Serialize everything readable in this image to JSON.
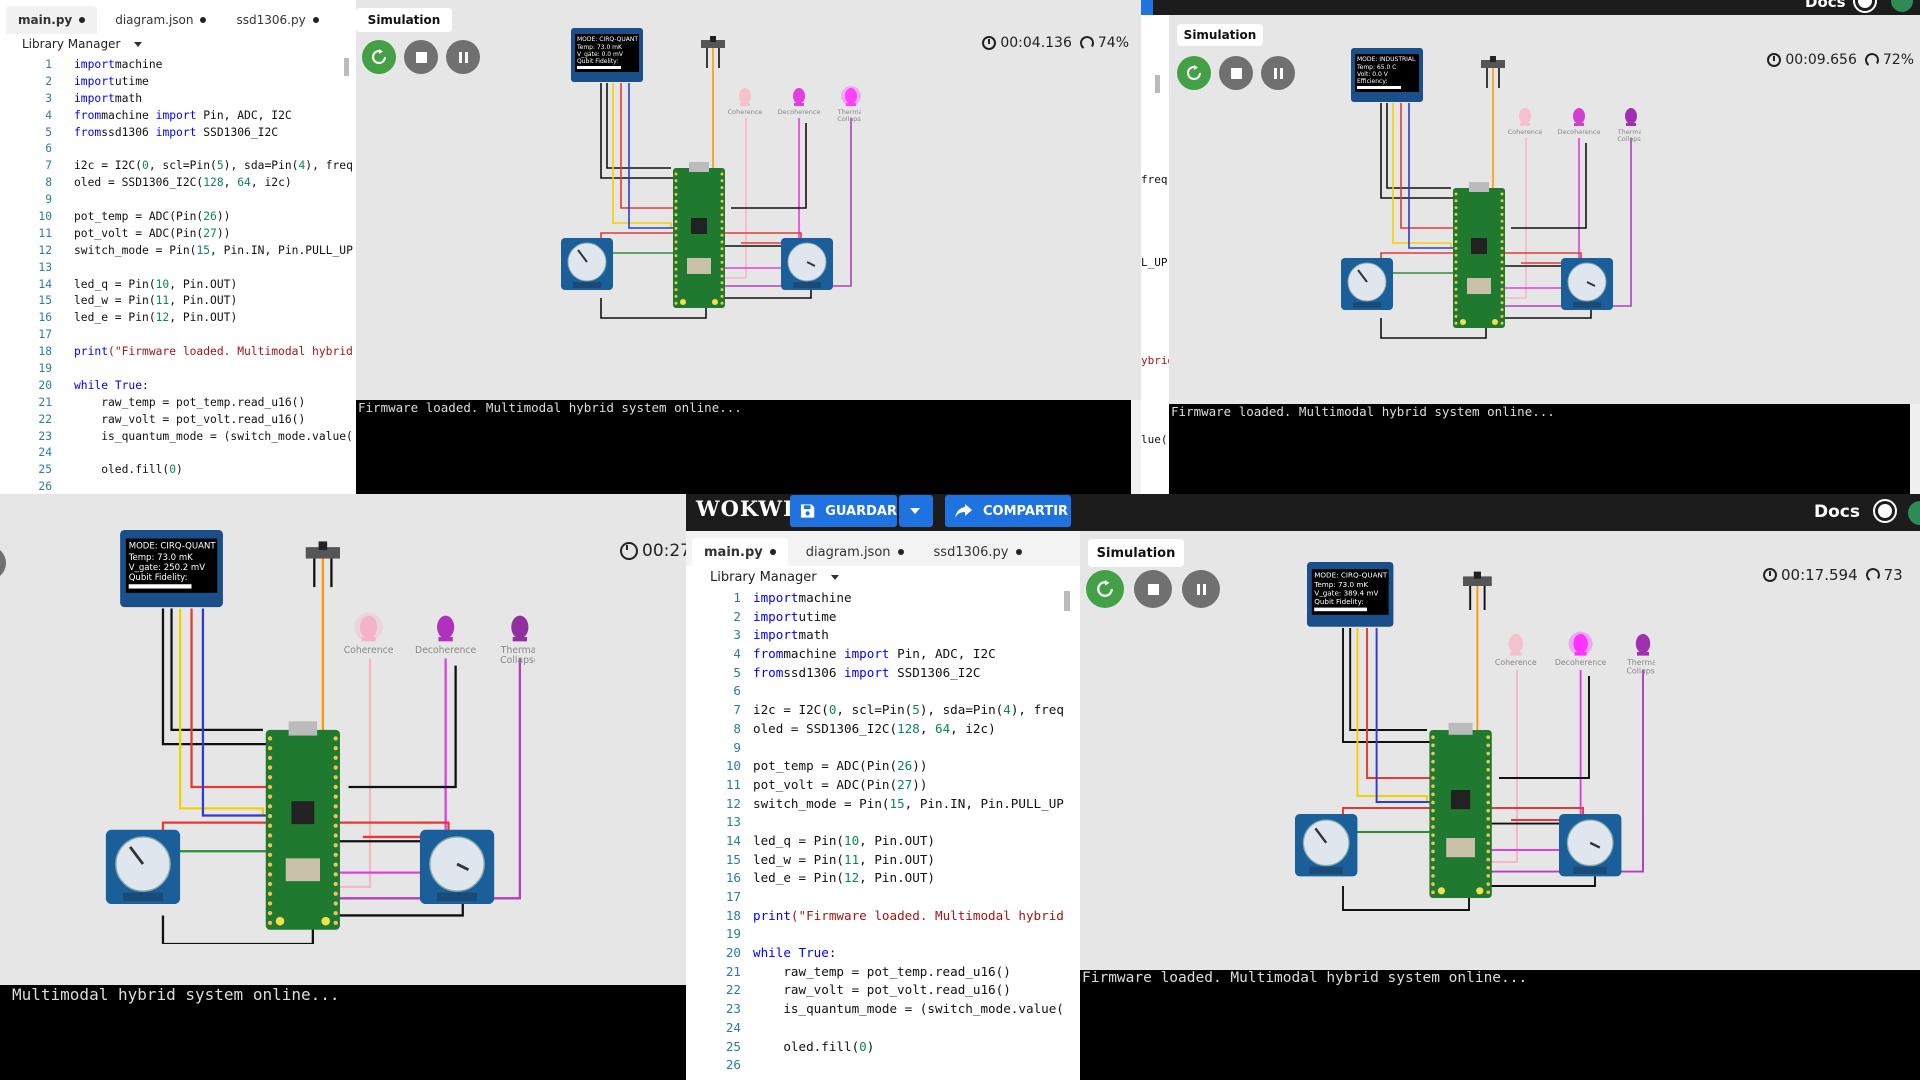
{
  "editor": {
    "tabs": [
      {
        "label": "main.py"
      },
      {
        "label": "diagram.json"
      },
      {
        "label": "ssd1306.py"
      }
    ],
    "library_manager": "Library Manager",
    "code": [
      {
        "n": "1",
        "t": [
          [
            "kw",
            "import"
          ],
          [
            "",
            "machine"
          ]
        ]
      },
      {
        "n": "2",
        "t": [
          [
            "kw",
            "import"
          ],
          [
            "",
            "utime"
          ]
        ]
      },
      {
        "n": "3",
        "t": [
          [
            "kw",
            "import"
          ],
          [
            "",
            "math"
          ]
        ]
      },
      {
        "n": "4",
        "t": [
          [
            "kw",
            "from"
          ],
          [
            "",
            "machine "
          ],
          [
            "kw",
            "import"
          ],
          [
            "",
            " Pin, ADC, I2C"
          ]
        ]
      },
      {
        "n": "5",
        "t": [
          [
            "kw",
            "from"
          ],
          [
            "",
            "ssd1306 "
          ],
          [
            "kw",
            "import"
          ],
          [
            "",
            " SSD1306_I2C"
          ]
        ]
      },
      {
        "n": "6",
        "t": []
      },
      {
        "n": "7",
        "t": [
          [
            "",
            "i2c = I2C("
          ],
          [
            "nm",
            "0"
          ],
          [
            "",
            ", scl=Pin("
          ],
          [
            "nm",
            "5"
          ],
          [
            "",
            "), sda=Pin("
          ],
          [
            "nm",
            "4"
          ],
          [
            "",
            "), freq"
          ]
        ]
      },
      {
        "n": "8",
        "t": [
          [
            "",
            "oled = SSD1306_I2C("
          ],
          [
            "nm",
            "128"
          ],
          [
            "",
            ", "
          ],
          [
            "nm",
            "64"
          ],
          [
            "",
            ", i2c)"
          ]
        ]
      },
      {
        "n": "9",
        "t": []
      },
      {
        "n": "10",
        "t": [
          [
            "",
            "pot_temp = ADC(Pin("
          ],
          [
            "nm",
            "26"
          ],
          [
            "",
            "))"
          ]
        ]
      },
      {
        "n": "11",
        "t": [
          [
            "",
            "pot_volt = ADC(Pin("
          ],
          [
            "nm",
            "27"
          ],
          [
            "",
            "))"
          ]
        ]
      },
      {
        "n": "12",
        "t": [
          [
            "",
            "switch_mode = Pin("
          ],
          [
            "nm",
            "15"
          ],
          [
            "",
            ", Pin.IN, Pin.PULL_UP"
          ]
        ]
      },
      {
        "n": "13",
        "t": []
      },
      {
        "n": "14",
        "t": [
          [
            "",
            "led_q = Pin("
          ],
          [
            "nm",
            "10"
          ],
          [
            "",
            ", Pin.OUT)"
          ]
        ]
      },
      {
        "n": "15",
        "t": [
          [
            "",
            "led_w = Pin("
          ],
          [
            "nm",
            "11"
          ],
          [
            "",
            ", Pin.OUT)"
          ]
        ]
      },
      {
        "n": "16",
        "t": [
          [
            "",
            "led_e = Pin("
          ],
          [
            "nm",
            "12"
          ],
          [
            "",
            ", Pin.OUT)"
          ]
        ]
      },
      {
        "n": "17",
        "t": []
      },
      {
        "n": "18",
        "t": [
          [
            "kw",
            "print"
          ],
          [
            "st",
            "(\"Firmware loaded. Multimodal hybrid"
          ]
        ]
      },
      {
        "n": "19",
        "t": []
      },
      {
        "n": "20",
        "t": [
          [
            "kw",
            "while"
          ],
          [
            "kw",
            " True"
          ],
          [
            "",
            ":"
          ]
        ]
      },
      {
        "n": "21",
        "t": [
          [
            "",
            "    raw_temp = pot_temp.read_u16()"
          ]
        ]
      },
      {
        "n": "22",
        "t": [
          [
            "",
            "    raw_volt = pot_volt.read_u16()"
          ]
        ]
      },
      {
        "n": "23",
        "t": [
          [
            "",
            "    is_quantum_mode = (switch_mode.value("
          ]
        ]
      },
      {
        "n": "24",
        "t": []
      },
      {
        "n": "25",
        "t": [
          [
            "",
            "    oled.fill("
          ],
          [
            "nm",
            "0"
          ],
          [
            "",
            ")"
          ]
        ]
      },
      {
        "n": "26",
        "t": []
      }
    ],
    "partial_right": {
      "l7": "freq",
      "l12": "L_UP",
      "l18": "ybrid",
      "l23": "lue("
    }
  },
  "simulation": {
    "tab_label": "Simulation",
    "console_full": "Firmware loaded. Multimodal hybrid system online...",
    "console_partial": "Multimodal hybrid system online...",
    "leds": [
      "Coherence",
      "Decoherence",
      "Thermal Collapse"
    ]
  },
  "panels": {
    "tl": {
      "time": "00:04.136",
      "speed": "74%",
      "oled_mode": "MODE: CIRQ-QUANT",
      "oled_l1": "Temp: 73.0 mK",
      "oled_l2": "V_gate: 0.0 mV",
      "oled_l3": "Qubit Fidelity:"
    },
    "tr": {
      "time": "00:09.656",
      "speed": "72%",
      "oled_mode": "MODE: INDUSTRIAL",
      "oled_l1": "Temp: 65.0 C",
      "oled_l2": "Volt: 0.0 V",
      "oled_l3": "Efficiency:"
    },
    "bl": {
      "time": "00:27",
      "oled_mode": "MODE: CIRQ-QUANT",
      "oled_l1": "Temp: 73.0 mK",
      "oled_l2": "V_gate: 250.2 mV",
      "oled_l3": "Qubit Fidelity:"
    },
    "br": {
      "time": "00:17.594",
      "speed": "73",
      "oled_mode": "MODE: CIRQ-QUANT",
      "oled_l1": "Temp: 73.0 mK",
      "oled_l2": "V_gate: 389.4 mV",
      "oled_l3": "Qubit Fidelity:"
    }
  },
  "topbar": {
    "logo": "WOKWI",
    "save": "GUARDAR",
    "share": "COMPARTIR",
    "docs": "Docs",
    "docs_tr": "Docs"
  },
  "colors": {
    "accent": "#1f73e0",
    "play": "#43a047",
    "console_bg": "#000000",
    "board": "#1f7a30",
    "pot": "#1b5f9a"
  }
}
